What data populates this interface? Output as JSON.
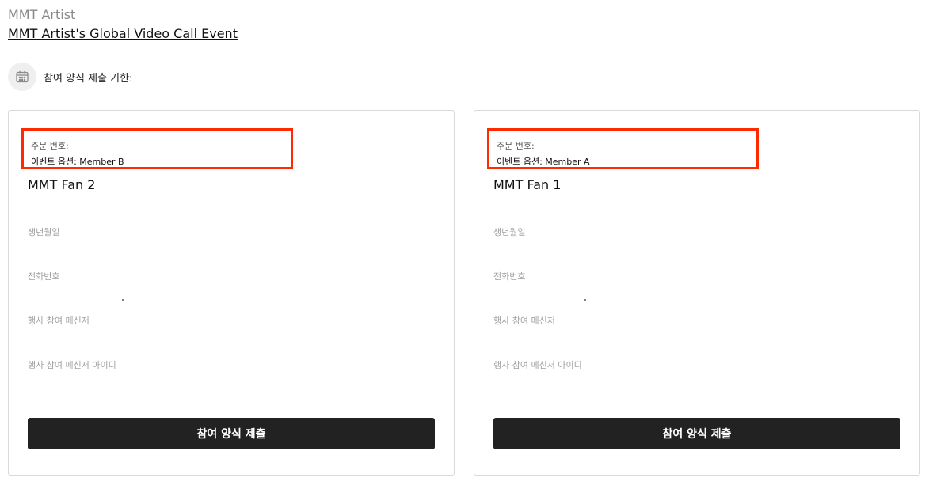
{
  "header": {
    "artist": "MMT Artist",
    "event_title": "MMT Artist's Global Video Call Event",
    "deadline_label": "참여 양식 제출 기한:"
  },
  "cards": [
    {
      "order_number_label": "주문 번호:",
      "event_option": "이벤트 옵션: Member B",
      "fan_name": "MMT Fan 2",
      "fields": [
        "생년월일",
        "전화번호",
        "행사 참여 메신저",
        "행사 참여 메신저 아이디"
      ],
      "submit_label": "참여 양식 제출"
    },
    {
      "order_number_label": "주문 번호:",
      "event_option": "이벤트 옵션: Member A",
      "fan_name": "MMT Fan 1",
      "fields": [
        "생년월일",
        "전화번호",
        "행사 참여 메신저",
        "행사 참여 메신저 아이디"
      ],
      "submit_label": "참여 양식 제출"
    }
  ],
  "colors": {
    "highlight_border": "#ff2a00",
    "button_bg": "#222222",
    "icon": "calendar-icon"
  }
}
